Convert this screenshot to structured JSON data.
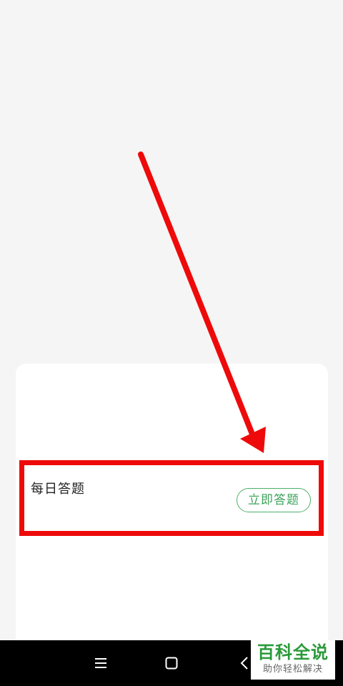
{
  "task_card": {
    "title": "每日答题",
    "action_label": "立即答题"
  },
  "annotation": {
    "color": "#ee0a0a"
  },
  "nav_bar": {
    "items": [
      "menu-icon",
      "home-icon",
      "back-icon"
    ]
  },
  "watermark": {
    "title": "百科全说",
    "subtitle": "助你轻松解决"
  },
  "colors": {
    "accent_green": "#3da35c",
    "background": "#f5f5f5"
  }
}
